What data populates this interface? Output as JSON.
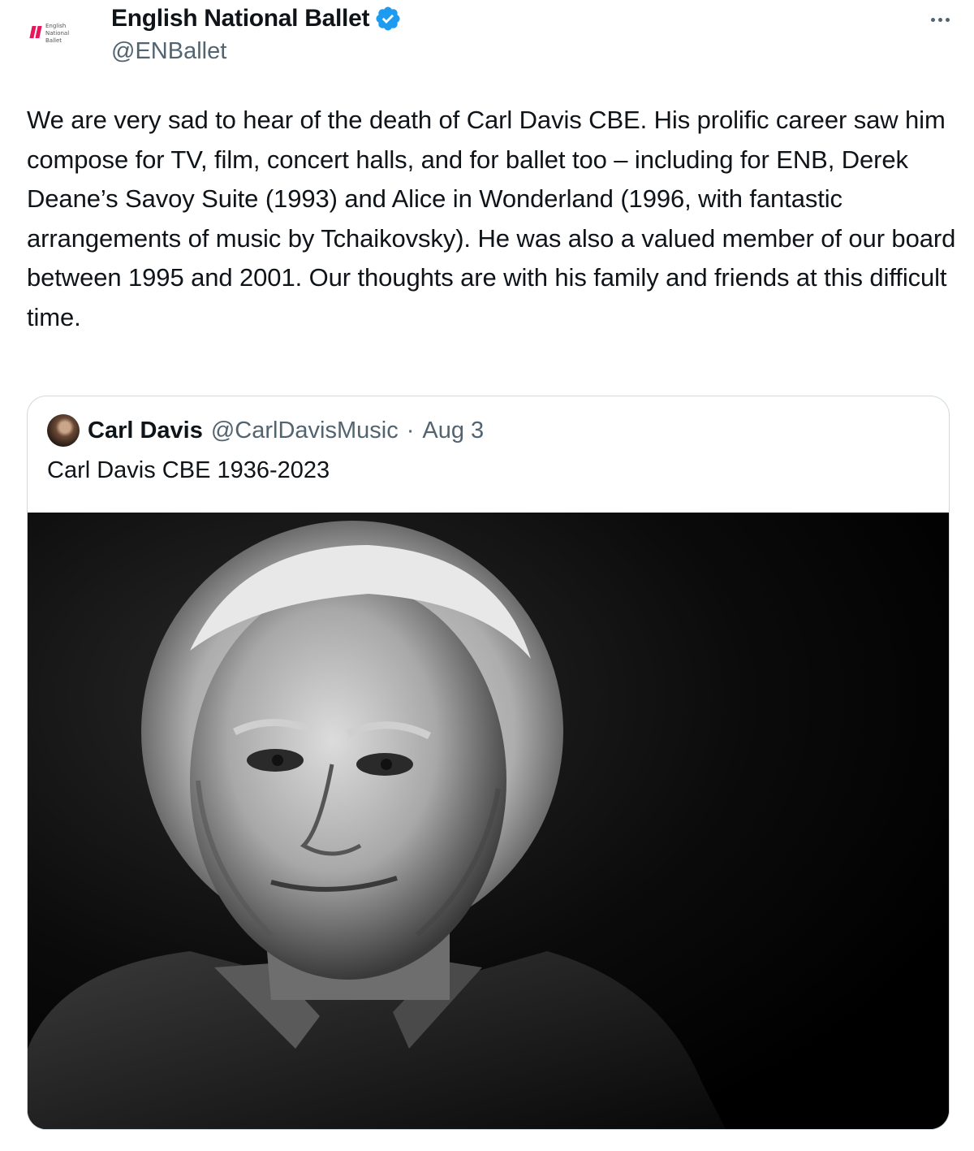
{
  "author": {
    "display_name": "English National Ballet",
    "handle": "@ENBallet",
    "avatar_brand": [
      "English",
      "National",
      "Ballet"
    ],
    "verified_icon": "verified-badge-icon",
    "brand_color": "#e4175c",
    "verified_color": "#1d9bf0"
  },
  "menu": {
    "more_icon": "more-dots-icon"
  },
  "tweet": {
    "text": "We are very sad to hear of the death of Carl Davis CBE. His prolific career saw him compose for TV, film, concert halls, and for ballet too – including for ENB, Derek Deane’s Savoy Suite (1993) and Alice in Wonderland (1996, with fantastic arrangements of music by Tchaikovsky). He was also a valued member of our board between 1995 and 2001. Our thoughts are with his family and friends at this difficult time."
  },
  "quoted": {
    "display_name": "Carl Davis",
    "handle": "@CarlDavisMusic",
    "separator": "·",
    "date": "Aug 3",
    "text": "Carl Davis CBE 1936-2023",
    "image_icon": "portrait-photo"
  }
}
